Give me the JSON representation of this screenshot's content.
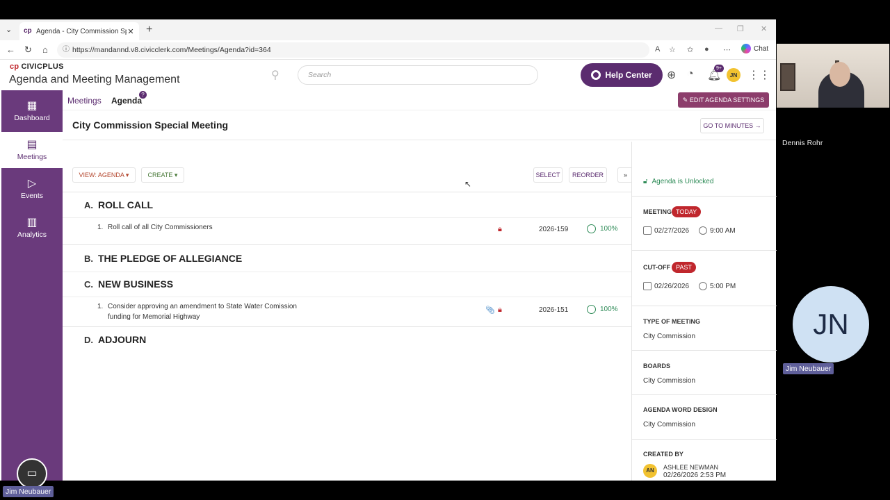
{
  "browser": {
    "tab_title": "Agenda - City Commission Special",
    "url": "https://mandannd.v8.civicclerk.com/Meetings/Agenda?id=364",
    "chat_label": "Chat"
  },
  "header": {
    "brand_top": "CIVICPLUS",
    "brand_sub": "Agenda and Meeting Management",
    "search_placeholder": "Search",
    "help_label": "Help Center",
    "notif_badge": "9+",
    "user_initials": "JN"
  },
  "sidebar": {
    "items": [
      {
        "label": "Dashboard",
        "icon": "grid-icon"
      },
      {
        "label": "Meetings",
        "icon": "meetings-icon"
      },
      {
        "label": "Events",
        "icon": "events-icon"
      },
      {
        "label": "Analytics",
        "icon": "analytics-icon"
      }
    ]
  },
  "breadcrumb": {
    "meetings": "Meetings",
    "agenda": "Agenda",
    "help": "?"
  },
  "page": {
    "title": "City Commission Special Meeting",
    "edit_settings": "EDIT AGENDA SETTINGS",
    "goto_minutes": "GO TO MINUTES →"
  },
  "toolbar": {
    "view": "VIEW: AGENDA",
    "create": "CREATE",
    "select": "SELECT",
    "reorder": "REORDER",
    "collapse": "»"
  },
  "agenda": {
    "sections": [
      {
        "letter": "A.",
        "title": "ROLL CALL"
      },
      {
        "letter": "B.",
        "title": "THE PLEDGE OF ALLEGIANCE"
      },
      {
        "letter": "C.",
        "title": "NEW BUSINESS"
      },
      {
        "letter": "D.",
        "title": "ADJOURN"
      }
    ],
    "items": [
      {
        "num": "1.",
        "text": "Roll call of all City Commissioners",
        "id": "2026-159",
        "pct": "100%"
      },
      {
        "num": "1.",
        "text": "Consider approving an amendment to State Water Comission funding for Memorial Highway",
        "id": "2026-151",
        "pct": "100%"
      }
    ]
  },
  "panel": {
    "unlocked": "Agenda is Unlocked",
    "meeting_label": "MEETING",
    "meeting_badge": "TODAY",
    "meeting_date": "02/27/2026",
    "meeting_time": "9:00 AM",
    "cutoff_label": "CUT-OFF",
    "cutoff_badge": "PAST",
    "cutoff_date": "02/26/2026",
    "cutoff_time": "5:00 PM",
    "type_label": "TYPE OF MEETING",
    "type_value": "City Commission",
    "boards_label": "BOARDS",
    "boards_value": "City Commission",
    "word_label": "AGENDA WORD DESIGN",
    "word_value": "City Commission",
    "created_label": "CREATED BY",
    "creator_initials": "AN",
    "creator_name": "ASHLEE NEWMAN",
    "created_at": "02/26/2026 2:53 PM"
  },
  "video": {
    "participant1": "Dennis Rohr",
    "participant2_initials": "JN",
    "participant2": "Jim Neubauer",
    "self_label": "Jim Neubauer"
  },
  "colors": {
    "brand": "#5b2c6f",
    "sidebar": "#6a3a7c",
    "badge_red": "#c0272d",
    "success": "#2e8b57"
  }
}
